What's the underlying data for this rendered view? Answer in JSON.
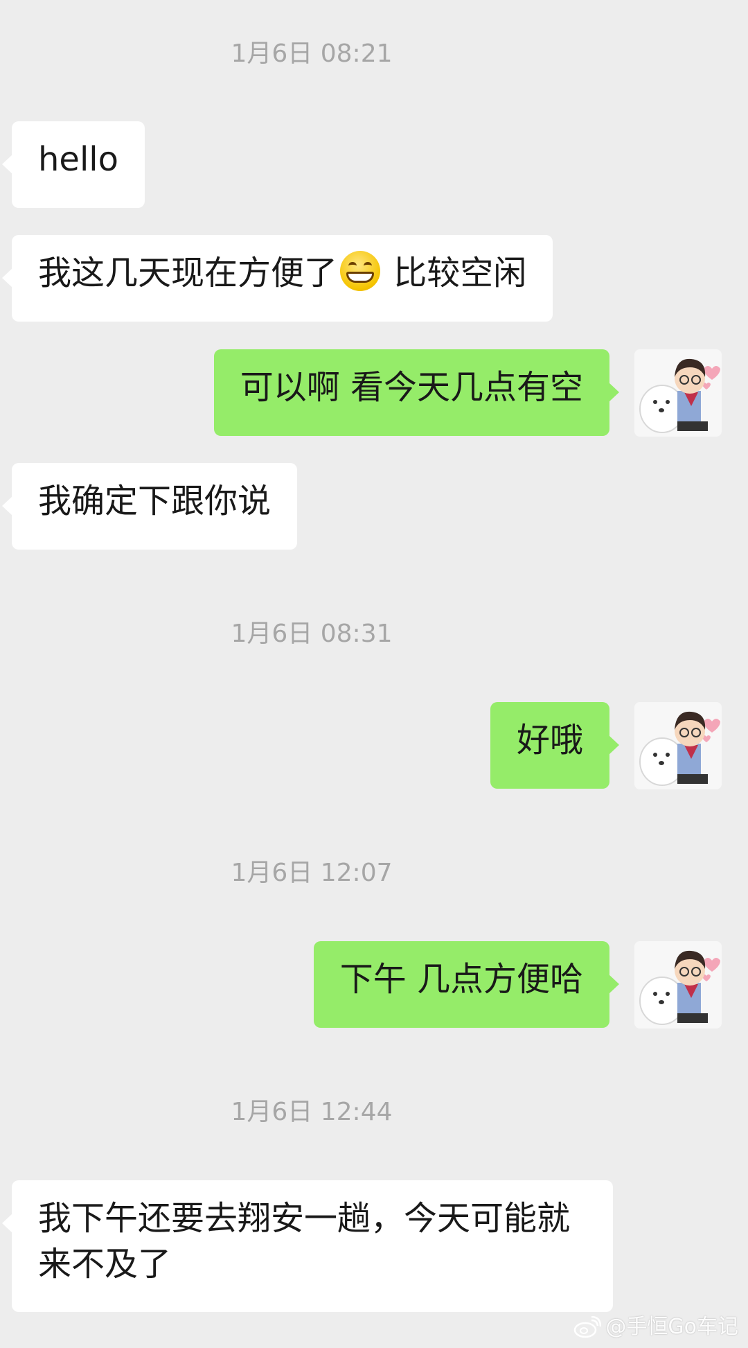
{
  "messages": [
    {
      "type": "time",
      "text": "1月6日 08:21"
    },
    {
      "type": "in",
      "text": "hello"
    },
    {
      "type": "in",
      "text_before": "我这几天现在方便了",
      "emoji": "grinning-face-emoji",
      "text_after": " 比较空闲"
    },
    {
      "type": "out",
      "text": "可以啊 看今天几点有空"
    },
    {
      "type": "in",
      "text": "我确定下跟你说"
    },
    {
      "type": "time",
      "text": "1月6日 08:31"
    },
    {
      "type": "out",
      "text": "好哦"
    },
    {
      "type": "time",
      "text": "1月6日 12:07"
    },
    {
      "type": "out",
      "text": "下午 几点方便哈"
    },
    {
      "type": "time",
      "text": "1月6日 12:44"
    },
    {
      "type": "in",
      "text": "我下午还要去翔安一趟，今天可能就来不及了"
    }
  ],
  "avatar": {
    "icon": "boy-with-dog-avatar"
  },
  "watermark": {
    "text": "@手恒Go车记",
    "icon": "weibo-icon"
  },
  "colors": {
    "background": "#ededed",
    "incoming_bubble": "#ffffff",
    "outgoing_bubble": "#95ec69",
    "timestamp": "#a6a6a6"
  }
}
